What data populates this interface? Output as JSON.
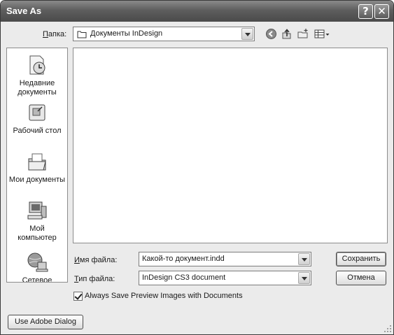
{
  "window": {
    "title": "Save As"
  },
  "titlebar_buttons": {
    "help": "?",
    "close": "✕"
  },
  "lookin": {
    "label_accel": "П",
    "label_rest": "апка:",
    "value": "Документы InDesign"
  },
  "toolbar_icons": [
    "back-icon",
    "up-folder-icon",
    "new-folder-icon",
    "view-menu-icon"
  ],
  "places": [
    {
      "icon": "recent-documents-icon",
      "line1": "Недавние",
      "line2": "документы"
    },
    {
      "icon": "desktop-icon",
      "line1": "Рабочий стол",
      "line2": ""
    },
    {
      "icon": "my-documents-icon",
      "line1": "Мои документы",
      "line2": ""
    },
    {
      "icon": "my-computer-icon",
      "line1": "Мой",
      "line2": "компьютер"
    },
    {
      "icon": "network-icon",
      "line1": "Сетевое",
      "line2": ""
    }
  ],
  "filename": {
    "label_accel": "И",
    "label_rest": "мя файла:",
    "value": "Какой-то документ.indd"
  },
  "filetype": {
    "label_accel": "Т",
    "label_rest": "ип файла:",
    "value": "InDesign CS3 document"
  },
  "buttons": {
    "save": "Сохранить",
    "cancel": "Отмена",
    "adobe_dialog": "Use Adobe Dialog"
  },
  "preview_checkbox": {
    "label": "Always Save Preview Images with Documents",
    "checked": true
  }
}
